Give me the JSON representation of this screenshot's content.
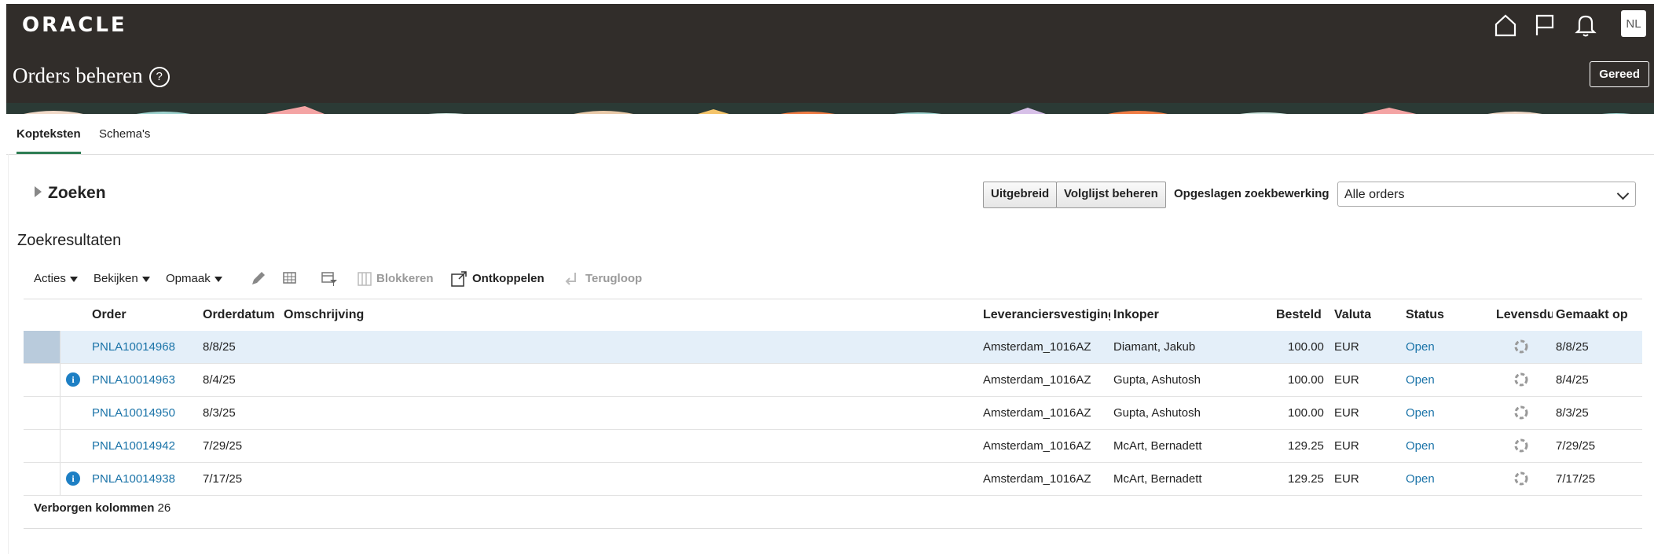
{
  "app": {
    "logo": "ORACLE",
    "page_title": "Orders beheren",
    "help_glyph": "?",
    "done_label": "Gereed",
    "avatar_initials": "NL"
  },
  "header_icons": [
    "home-icon",
    "flag-icon",
    "bell-icon"
  ],
  "tabs": [
    {
      "label": "Kopteksten",
      "active": true
    },
    {
      "label": "Schema's",
      "active": false
    }
  ],
  "search": {
    "title": "Zoeken",
    "advanced_label": "Uitgebreid",
    "watchlist_label": "Volglijst beheren",
    "saved_search_label": "Opgeslagen zoekbewerking",
    "saved_search_value": "Alle orders"
  },
  "results": {
    "title": "Zoekresultaten",
    "toolbar": {
      "actions": "Acties",
      "view": "Bekijken",
      "format": "Opmaak",
      "block": "Blokkeren",
      "detach": "Ontkoppelen",
      "rollback": "Terugloop"
    },
    "columns": [
      "Order",
      "Orderdatum",
      "Omschrijving",
      "Leveranciersvestiging",
      "Inkoper",
      "Besteld",
      "Valuta",
      "Status",
      "Levensduur",
      "Gemaakt op"
    ],
    "rows": [
      {
        "info": false,
        "order": "PNLA10014968",
        "date": "8/8/25",
        "description": "",
        "site": "Amsterdam_1016AZ",
        "buyer": "Diamant, Jakub",
        "ordered": "100.00",
        "currency": "EUR",
        "status": "Open",
        "created": "8/8/25"
      },
      {
        "info": true,
        "order": "PNLA10014963",
        "date": "8/4/25",
        "description": "",
        "site": "Amsterdam_1016AZ",
        "buyer": "Gupta, Ashutosh",
        "ordered": "100.00",
        "currency": "EUR",
        "status": "Open",
        "created": "8/4/25"
      },
      {
        "info": false,
        "order": "PNLA10014950",
        "date": "8/3/25",
        "description": "",
        "site": "Amsterdam_1016AZ",
        "buyer": "Gupta, Ashutosh",
        "ordered": "100.00",
        "currency": "EUR",
        "status": "Open",
        "created": "8/3/25"
      },
      {
        "info": false,
        "order": "PNLA10014942",
        "date": "7/29/25",
        "description": "",
        "site": "Amsterdam_1016AZ",
        "buyer": "McArt, Bernadett",
        "ordered": "129.25",
        "currency": "EUR",
        "status": "Open",
        "created": "7/29/25"
      },
      {
        "info": true,
        "order": "PNLA10014938",
        "date": "7/17/25",
        "description": "",
        "site": "Amsterdam_1016AZ",
        "buyer": "McArt, Bernadett",
        "ordered": "129.25",
        "currency": "EUR",
        "status": "Open",
        "created": "7/17/25"
      }
    ],
    "hidden_columns_label": "Verborgen kolommen",
    "hidden_columns_count": "26",
    "selected_row": 0
  },
  "colors": {
    "header_bg": "#312d2a",
    "link": "#1a73a8",
    "active_tab": "#2e7d54",
    "selected_row": "#e4eff9",
    "info_badge": "#1d7fc4"
  }
}
